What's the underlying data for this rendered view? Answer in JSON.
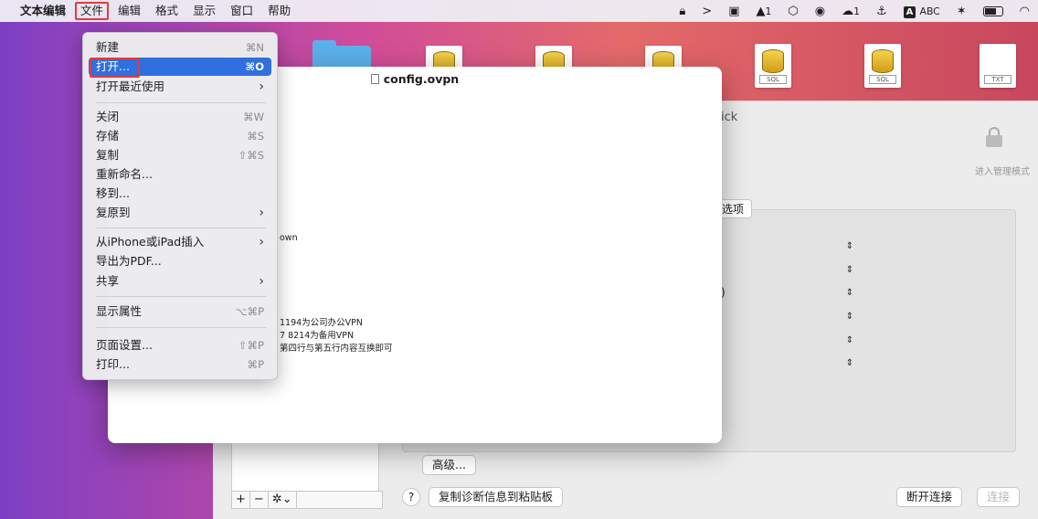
{
  "menubar": {
    "app_name": "文本编辑",
    "items": [
      "文件",
      "编辑",
      "格式",
      "显示",
      "窗口",
      "帮助"
    ]
  },
  "status": {
    "notif_count": "1",
    "cloud_count": "1",
    "input_label": "ABC"
  },
  "desktop_icons": [
    {
      "label": "SQL"
    },
    {
      "label": "SQL"
    },
    {
      "label": "TXT"
    }
  ],
  "document": {
    "title": "config.ovpn",
    "lines": [
      "own",
      "1194为公司办公VPN",
      "7  8214为备用VPN",
      "第四行与第五行内容互换即可"
    ]
  },
  "settings": {
    "header_fragment": "ick",
    "admin_label": "进入管理模式",
    "options_label": "选项",
    "row_fragment": ":)",
    "advanced_button": "高级...",
    "help_button": "?",
    "copy_diag_button": "复制诊断信息到粘贴板",
    "disconnect_button": "断开连接",
    "connect_button": "连接",
    "plus": "+",
    "minus": "−",
    "gear": "✲⌄"
  },
  "file_menu": {
    "items": [
      {
        "label": "新建",
        "shortcut": "⌘N"
      },
      {
        "label": "打开...",
        "shortcut": "⌘O",
        "highlighted": true
      },
      {
        "label": "打开最近使用",
        "shortcut": "›"
      },
      {
        "label": "关闭",
        "shortcut": "⌘W"
      },
      {
        "label": "存储",
        "shortcut": "⌘S"
      },
      {
        "label": "复制",
        "shortcut": "⇧⌘S"
      },
      {
        "label": "重新命名...",
        "shortcut": ""
      },
      {
        "label": "移到...",
        "shortcut": ""
      },
      {
        "label": "复原到",
        "shortcut": "›"
      },
      {
        "label": "从iPhone或iPad插入",
        "shortcut": "›"
      },
      {
        "label": "导出为PDF...",
        "shortcut": ""
      },
      {
        "label": "共享",
        "shortcut": "›"
      },
      {
        "label": "显示属性",
        "shortcut": "⌥⌘P"
      },
      {
        "label": "页面设置...",
        "shortcut": "⇧⌘P"
      },
      {
        "label": "打印...",
        "shortcut": "⌘P"
      }
    ]
  }
}
